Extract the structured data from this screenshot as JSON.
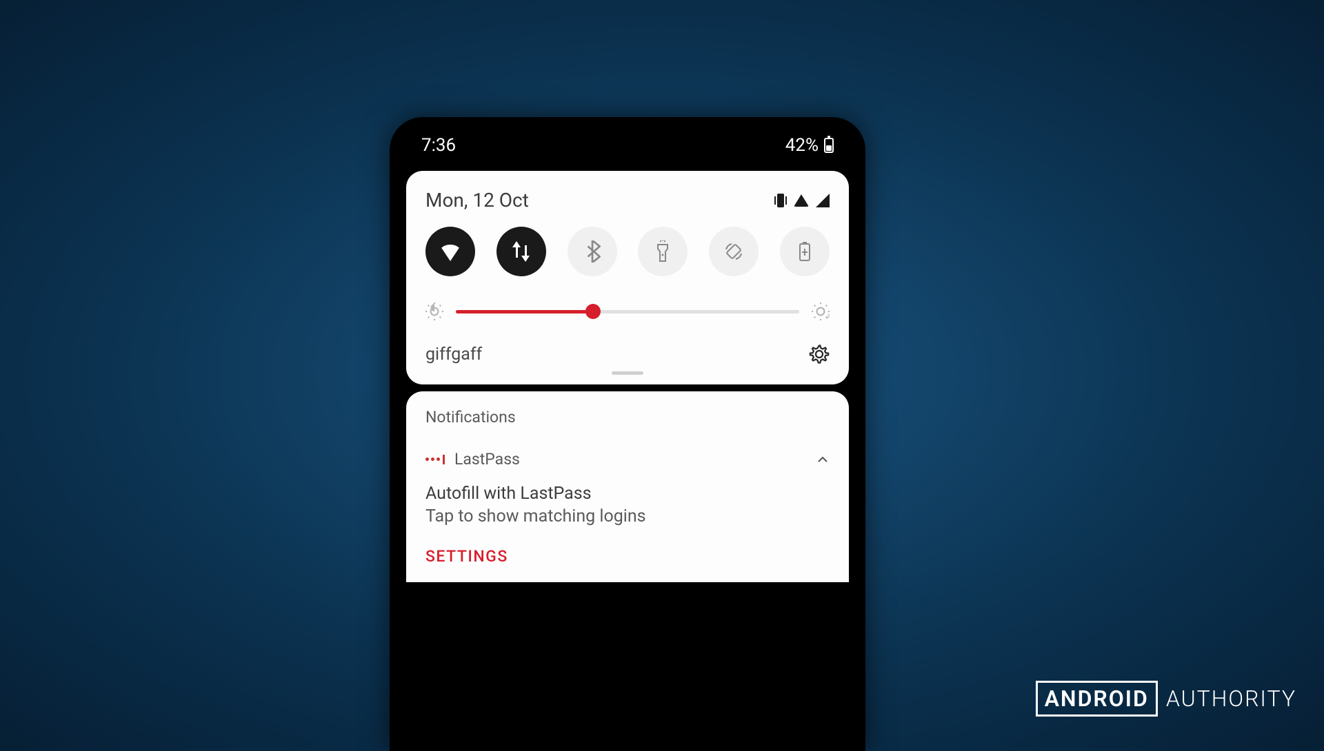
{
  "status_bar": {
    "time": "7:36",
    "battery_percent": "42%"
  },
  "quick_settings": {
    "date": "Mon, 12 Oct",
    "tiles": {
      "wifi": "wifi",
      "data": "mobile-data",
      "bluetooth": "bluetooth",
      "flashlight": "flashlight",
      "rotate": "auto-rotate",
      "battery_saver": "battery-saver"
    },
    "brightness_percent": 40,
    "carrier": "giffgaff"
  },
  "notifications": {
    "header": "Notifications",
    "items": [
      {
        "app": "LastPass",
        "title": "Autofill with LastPass",
        "body": "Tap to show matching logins",
        "action": "SETTINGS"
      }
    ]
  },
  "watermark": {
    "boxed": "ANDROID",
    "plain": "AUTHORITY"
  }
}
